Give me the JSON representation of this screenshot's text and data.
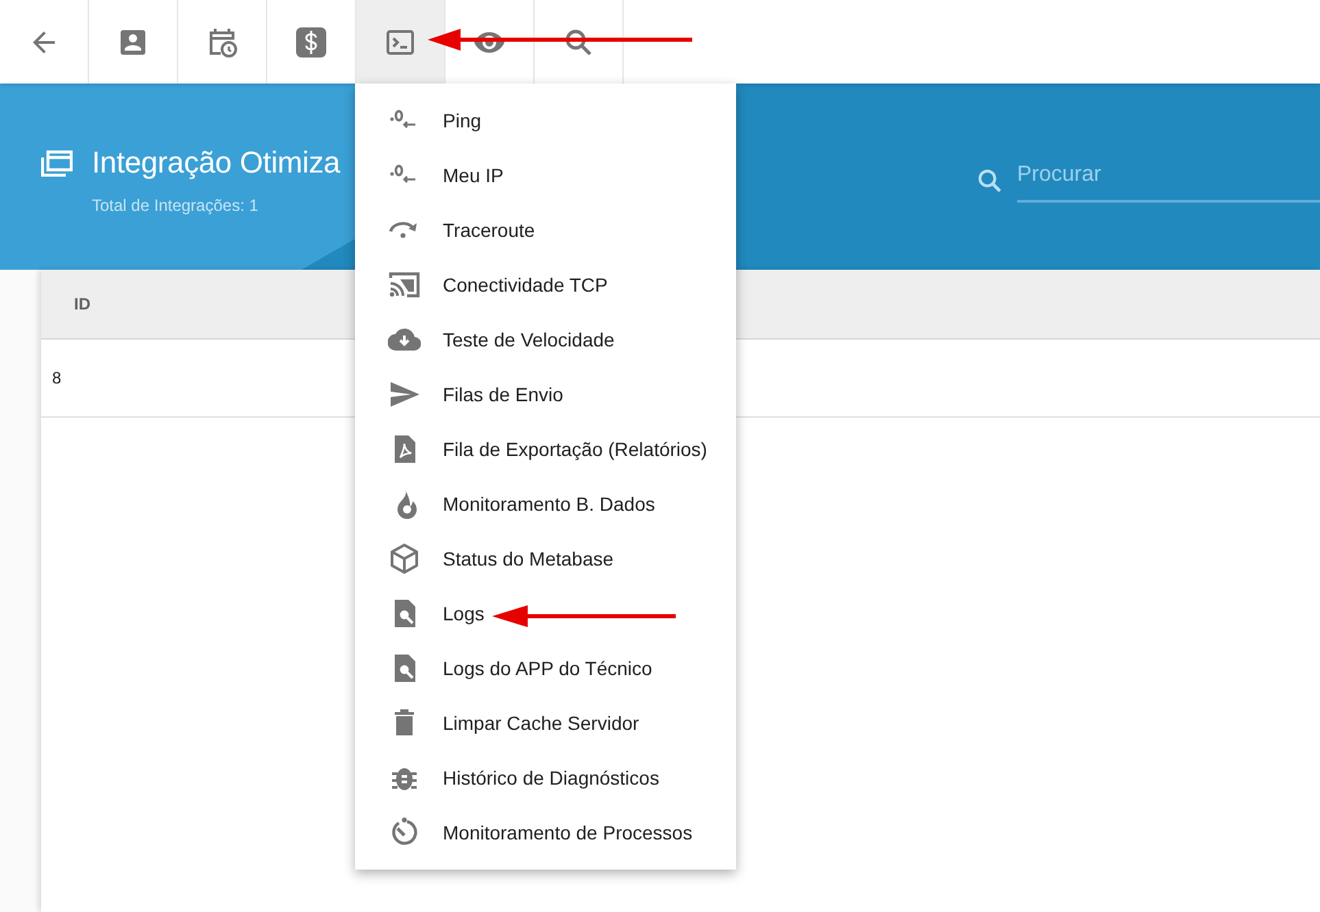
{
  "toolbar": {
    "buttons": [
      {
        "selected": false
      },
      {
        "selected": false
      },
      {
        "selected": false
      },
      {
        "selected": false
      },
      {
        "selected": true
      },
      {
        "selected": false
      },
      {
        "selected": false
      }
    ]
  },
  "header": {
    "title": "Integração Otimiza",
    "subtitle": "Total de Integrações: 1",
    "search": {
      "placeholder": "Procurar"
    }
  },
  "table": {
    "columns": [
      "ID"
    ],
    "rows": [
      [
        "8"
      ]
    ]
  },
  "menu": {
    "items": [
      {
        "label": "Ping"
      },
      {
        "label": "Meu IP"
      },
      {
        "label": "Traceroute"
      },
      {
        "label": "Conectividade TCP"
      },
      {
        "label": "Teste de Velocidade"
      },
      {
        "label": "Filas de Envio"
      },
      {
        "label": "Fila de Exportação (Relatórios)"
      },
      {
        "label": "Monitoramento B. Dados"
      },
      {
        "label": "Status do Metabase"
      },
      {
        "label": "Logs"
      },
      {
        "label": "Logs do APP do Técnico"
      },
      {
        "label": "Limpar Cache Servidor"
      },
      {
        "label": "Histórico de Diagnósticos"
      },
      {
        "label": "Monitoramento de Processos"
      }
    ]
  }
}
